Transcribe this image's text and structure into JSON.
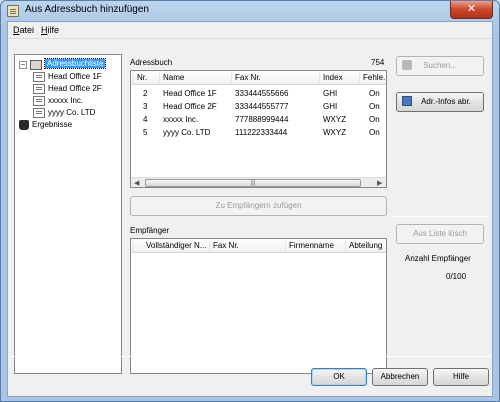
{
  "window": {
    "title": "Aus Adressbuch hinzufügen",
    "close_glyph": "✕"
  },
  "menu": [
    {
      "label": "Datei",
      "accel": "D"
    },
    {
      "label": "Hilfe",
      "accel": "H"
    }
  ],
  "tree": {
    "root": {
      "label": "Adressbuchliste",
      "icon": "address-book-icon",
      "expander": "−"
    },
    "children": [
      {
        "label": "Head Office 1F",
        "icon": "address-card-icon"
      },
      {
        "label": "Head Office 2F",
        "icon": "address-card-icon"
      },
      {
        "label": "xxxxx Inc.",
        "icon": "address-card-icon"
      },
      {
        "label": "yyyy Co. LTD",
        "icon": "address-card-icon"
      }
    ],
    "results": {
      "label": "Ergebnisse",
      "icon": "binoculars-icon"
    }
  },
  "address_book": {
    "label": "Adressbuch",
    "count": "754",
    "columns": [
      "Nr.",
      "Name",
      "Fax Nr.",
      "Index",
      "Fehle..."
    ],
    "rows": [
      [
        "2",
        "Head Office 1F",
        "333444555666",
        "GHI",
        "On"
      ],
      [
        "3",
        "Head Office 2F",
        "333444555777",
        "GHI",
        "On"
      ],
      [
        "4",
        "xxxxx Inc.",
        "777888999444",
        "WXYZ",
        "On"
      ],
      [
        "5",
        "yyyy Co. LTD",
        "111222333444",
        "WXYZ",
        "On"
      ]
    ]
  },
  "add_to_recipients_label": "Zu Empfängern zufügen",
  "recipients": {
    "label": "Empfänger",
    "columns": [
      "Vollständiger N...",
      "Fax Nr.",
      "Firmenname",
      "Abteilung"
    ],
    "rows": []
  },
  "side": {
    "search_label": "Suchen...",
    "address_info_label": "Adr.-Infos abr.",
    "remove_label": "Aus Liste lösch",
    "recipient_count_label": "Anzahl Empfänger",
    "recipient_count_value": "0/100"
  },
  "footer": {
    "ok": "OK",
    "cancel": "Abbrechen",
    "help": "Hilfe"
  }
}
